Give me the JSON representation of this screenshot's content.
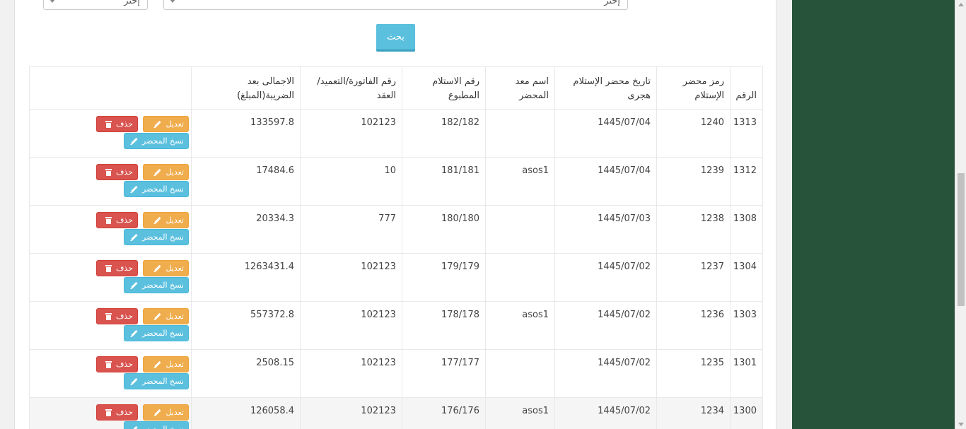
{
  "filters": {
    "select_small_value": "إختر",
    "select_large_value": "إختر"
  },
  "search": {
    "label": "بحث"
  },
  "table": {
    "headers": [
      "الرقم",
      "رمز محضر الإستلام",
      "تاريخ محضر الإستلام هجرى",
      "اسم معد المحضر",
      "رقم الاستلام المطبوع",
      "رقم الفاتورة/التعميد/العقد",
      "الاجمالى بعد الضريبة(المبلغ)",
      ""
    ],
    "rows": [
      {
        "num": "1313",
        "code": "1240",
        "date": "1445/07/04",
        "author": "",
        "printed": "182/182",
        "invoice": "102123",
        "total": "133597.8"
      },
      {
        "num": "1312",
        "code": "1239",
        "date": "1445/07/04",
        "author": "asos1",
        "printed": "181/181",
        "invoice": "10",
        "total": "17484.6"
      },
      {
        "num": "1308",
        "code": "1238",
        "date": "1445/07/03",
        "author": "",
        "printed": "180/180",
        "invoice": "777",
        "total": "20334.3"
      },
      {
        "num": "1304",
        "code": "1237",
        "date": "1445/07/02",
        "author": "",
        "printed": "179/179",
        "invoice": "102123",
        "total": "1263431.4"
      },
      {
        "num": "1303",
        "code": "1236",
        "date": "1445/07/02",
        "author": "asos1",
        "printed": "178/178",
        "invoice": "102123",
        "total": "557372.8"
      },
      {
        "num": "1301",
        "code": "1235",
        "date": "1445/07/02",
        "author": "",
        "printed": "177/177",
        "invoice": "102123",
        "total": "2508.15"
      },
      {
        "num": "1300",
        "code": "1234",
        "date": "1445/07/02",
        "author": "asos1",
        "printed": "176/176",
        "invoice": "102123",
        "total": "126058.4"
      }
    ],
    "actions": {
      "edit": "تعديل",
      "delete": "حذف",
      "copy": "نسخ المحضر"
    }
  },
  "colors": {
    "sidebar": "#27533a",
    "edit": "#f0ad4e",
    "delete": "#d9534f",
    "copy": "#5bc0de"
  }
}
